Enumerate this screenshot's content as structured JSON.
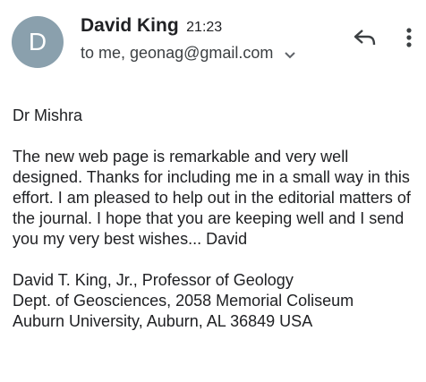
{
  "header": {
    "avatar_letter": "D",
    "avatar_color": "#8aa0ad",
    "sender_name": "David King",
    "time": "21:23",
    "recipient": "to me, geonag@gmail.com",
    "icons": {
      "reply": "reply-icon",
      "more": "more-vert-icon",
      "expand": "chevron-down-icon"
    }
  },
  "message": {
    "greeting": "Dr Mishra",
    "paragraphs": [
      "The new web page is remarkable and very well designed.  Thanks for including me in a small way in this effort. I am pleased to help out in the editorial matters of the journal.  I hope that you are keeping well and I send you my very best wishes... David"
    ],
    "signature": [
      "David T. King, Jr., Professor of Geology",
      "Dept. of Geosciences, 2058 Memorial Coliseum",
      "Auburn University, Auburn, AL 36849 USA"
    ]
  }
}
